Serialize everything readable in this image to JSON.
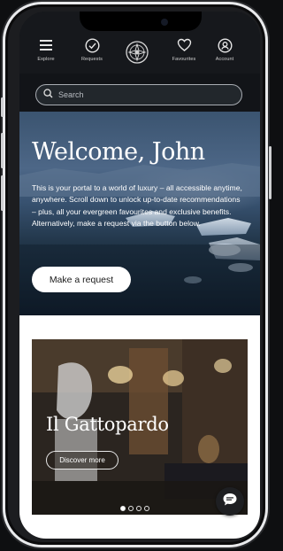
{
  "nav": {
    "items": [
      {
        "label": "Explore",
        "icon": "menu-icon"
      },
      {
        "label": "Requests",
        "icon": "check-circle-icon"
      },
      {
        "label": "Favourites",
        "icon": "heart-icon"
      },
      {
        "label": "Account",
        "icon": "account-icon"
      }
    ],
    "logo_icon": "brand-logo-icon"
  },
  "search": {
    "placeholder": "Search",
    "value": ""
  },
  "hero": {
    "title": "Welcome, John",
    "text": "This is your portal to a world of luxury – all accessible anytime, anywhere. Scroll down to unlock up-to-date recommendations – plus, all your evergreen favourites and exclusive benefits. Alternatively, make a request via the button below.",
    "button_label": "Make a request"
  },
  "card": {
    "title": "Il Gattopardo",
    "button_label": "Discover more",
    "slide_count": 4,
    "active_slide": 1
  },
  "chat": {
    "icon": "chat-bubble-icon"
  },
  "colors": {
    "nav_bg": "#16181c",
    "button_bg": "#ffffff",
    "page_bg": "#ffffff"
  }
}
